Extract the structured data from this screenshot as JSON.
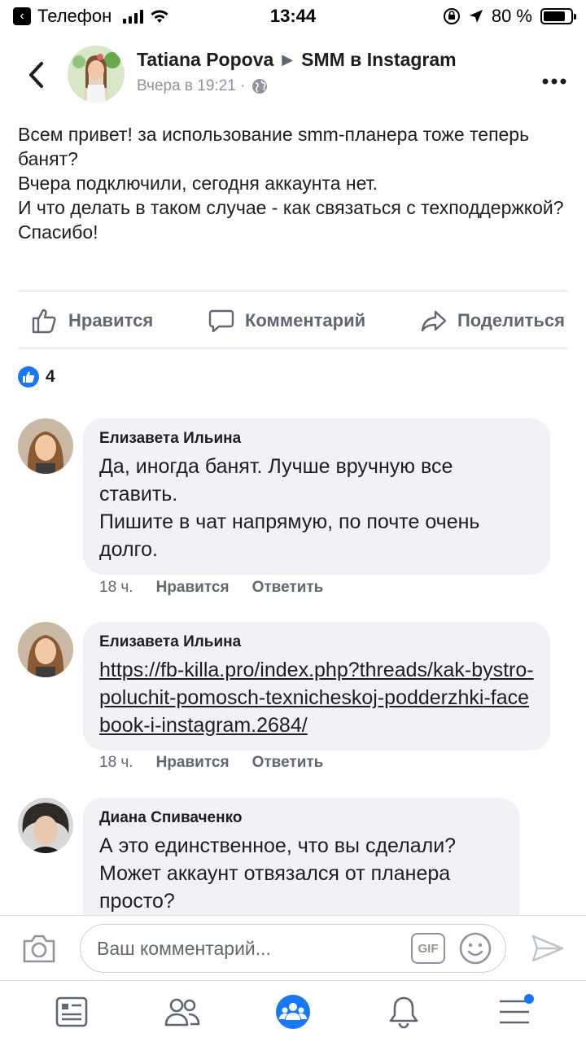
{
  "status_bar": {
    "carrier": "Телефон",
    "time": "13:44",
    "battery": "80 %",
    "battery_level": 0.8
  },
  "header": {
    "author": "Tatiana Popova",
    "group": "SMM в Instagram",
    "timestamp": "Вчера в 19:21 ·"
  },
  "post": {
    "lines": [
      "Всем привет! за использование smm-планера тоже теперь банят?",
      "Вчера подключили, сегодня аккаунта нет.",
      "И что делать в таком случае - как связаться с техподдержкой?",
      "Спасибо!"
    ]
  },
  "actions": {
    "like": "Нравится",
    "comment": "Комментарий",
    "share": "Поделиться"
  },
  "likes": {
    "count": "4"
  },
  "comments": [
    {
      "name": "Елизавета Ильина",
      "text": "Да, иногда банят. Лучше вручную все ставить.\nПишите в чат напрямую, по почте очень долго.",
      "time": "18 ч.",
      "like": "Нравится",
      "reply": "Ответить"
    },
    {
      "name": "Елизавета Ильина",
      "link": "https://fb-killa.pro/index.php?threads/kak-bystro-poluchit-pomosch-texnicheskoj-podderzhki-facebook-i-instagram.2684/",
      "time": "18 ч.",
      "like": "Нравится",
      "reply": "Ответить"
    },
    {
      "name": "Диана Спиваченко",
      "text": "А это единственное, что вы сделали? Может аккаунт отвязался от планера просто?"
    }
  ],
  "input": {
    "placeholder": "Ваш комментарий...",
    "gif": "GIF"
  },
  "colors": {
    "accent": "#1877f2",
    "bubble": "#f0f2f5",
    "muted": "#606770"
  }
}
